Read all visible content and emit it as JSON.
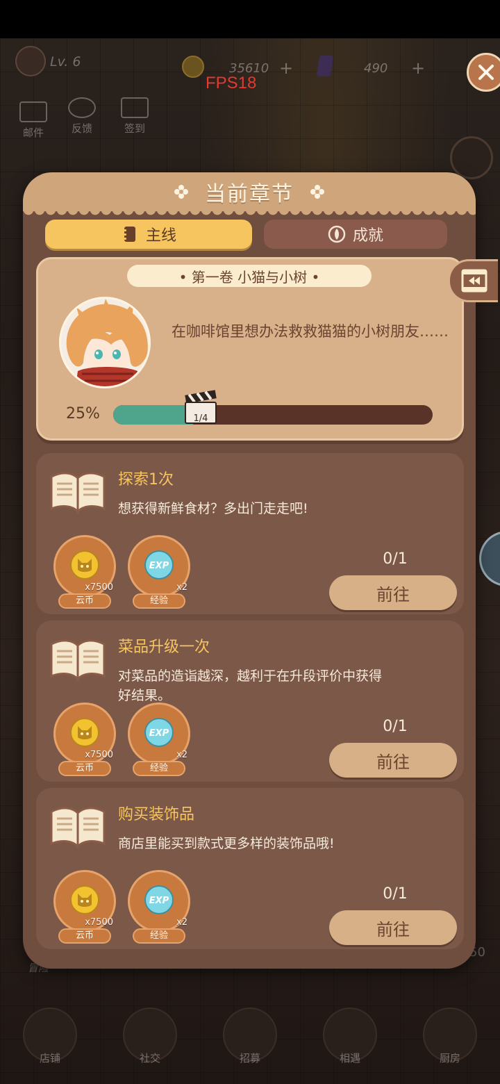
{
  "hud": {
    "level": "Lv. 6",
    "coins": "35610",
    "gems": "490",
    "plus": "+",
    "fps": "FPS18"
  },
  "side_buttons": [
    {
      "label": "邮件",
      "icon": "mail-icon"
    },
    {
      "label": "反馈",
      "icon": "globe-icon"
    },
    {
      "label": "签到",
      "icon": "checkin-icon"
    }
  ],
  "background": {
    "adventure_label": "冒险",
    "number": "50"
  },
  "bottom_nav": [
    {
      "label": "店铺",
      "icon": "shop-icon"
    },
    {
      "label": "社交",
      "icon": "coffee-icon"
    },
    {
      "label": "招募",
      "icon": "recruit-icon"
    },
    {
      "label": "相遇",
      "icon": "handshake-icon"
    },
    {
      "label": "厨房",
      "icon": "pan-icon"
    }
  ],
  "panel": {
    "title": "当前章节",
    "tabs": [
      {
        "label": "主线",
        "icon": "notebook-icon",
        "active": true
      },
      {
        "label": "成就",
        "icon": "medal-icon",
        "active": false
      }
    ],
    "chapter": {
      "title": "• 第一卷 小猫与小树 •",
      "description": "在咖啡馆里想办法救救猫猫的小树朋友……",
      "percent_label": "25%",
      "progress": 0.25,
      "step_label": "1/4"
    },
    "tasks": [
      {
        "title": "探索1次",
        "description": "想获得新鲜食材？多出门走走吧!",
        "rewards": [
          {
            "name": "云币",
            "qty": "x7500",
            "icon": "coin-icon"
          },
          {
            "name": "经验",
            "qty": "x2",
            "icon": "exp-icon"
          }
        ],
        "count": "0/1",
        "button": "前往"
      },
      {
        "title": "菜品升级一次",
        "description": "对菜品的造诣越深，越利于在升段评价中获得好结果。",
        "rewards": [
          {
            "name": "云币",
            "qty": "x7500",
            "icon": "coin-icon"
          },
          {
            "name": "经验",
            "qty": "x2",
            "icon": "exp-icon"
          }
        ],
        "count": "0/1",
        "button": "前往"
      },
      {
        "title": "购买装饰品",
        "description": "商店里能买到款式更多样的装饰品哦!",
        "rewards": [
          {
            "name": "云币",
            "qty": "x7500",
            "icon": "coin-icon"
          },
          {
            "name": "经验",
            "qty": "x2",
            "icon": "exp-icon"
          }
        ],
        "count": "0/1",
        "button": "前往"
      }
    ]
  },
  "colors": {
    "panel_bg": "#6f4e3f",
    "header_bg": "#cfa67b",
    "active_tab": "#f6c560",
    "progress_fill": "#4ea58c",
    "task_title": "#f6c560",
    "fps_text": "#e53a2f"
  }
}
